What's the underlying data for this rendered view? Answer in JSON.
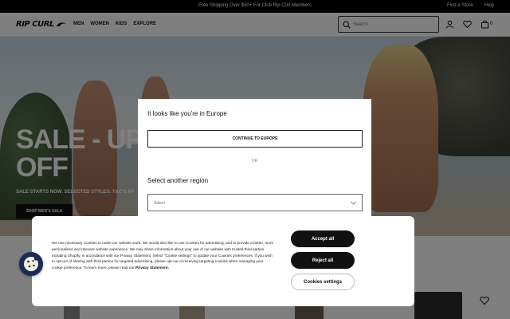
{
  "announcement": {
    "promo_text": "Free Shipping Over $50+ For Club Rip Curl Members",
    "find_store": "Find a Store",
    "help": "Help"
  },
  "header": {
    "logo_text": "RIP CURL",
    "nav": [
      "MEN",
      "WOMEN",
      "KIDS",
      "EXPLORE"
    ],
    "search_placeholder": "Search",
    "cart_count": "0"
  },
  "hero": {
    "headline_line1": "SALE - UP T",
    "headline_line2": "OFF",
    "subline": "SALE STARTS NOW. SELECTED STYLES. T&C'S AP",
    "cta": "SHOP MEN'S SALE"
  },
  "region_modal": {
    "title": "It looks like you're in Europe",
    "continue_label": "CONTINUE TO EUROPE",
    "or_text": "OR",
    "other_title": "Select another region",
    "select_value": "Select"
  },
  "cookie_banner": {
    "text": "We use necessary Cookies to make our website work. We would also like to use Cookies for advertising, and to provide a better, more personalised and relevant website experience. We may share information about your use of our website with trusted third parties including Shopify, in accordance with our Privacy Statement. Select \"Cookie settings\" to update your Cookies preferences. If you wish to opt-out of sharing with third parties for targeted advertising, please opt-out of receiving targeting cookies when managing your cookie preference. To learn more, please read our",
    "link_text": "Privacy Statement.",
    "accept_all": "Accept all",
    "reject_all": "Reject all",
    "settings": "Cookies settings"
  },
  "colors": {
    "overlay": "rgba(0,0,0,0.5)",
    "button_dark": "#111111",
    "cookie_fab": "#1d2a55"
  }
}
